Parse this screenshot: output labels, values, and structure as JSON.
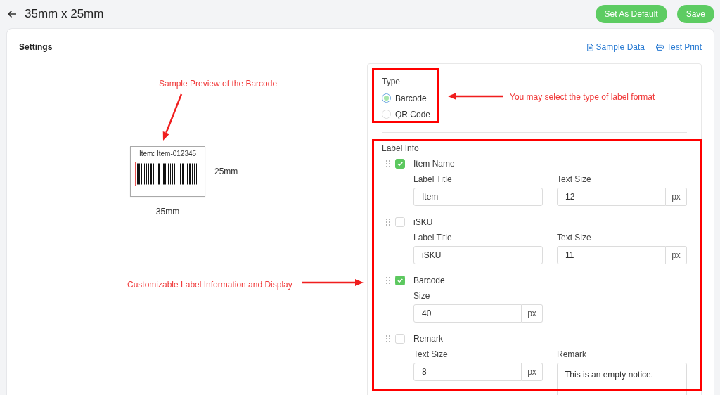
{
  "header": {
    "title": "35mm x 25mm",
    "buttons": [
      "Set As Default",
      "Save"
    ]
  },
  "settings": {
    "title": "Settings",
    "links": [
      {
        "label": "Sample Data",
        "kind": "document"
      },
      {
        "label": "Test Print",
        "kind": "print"
      }
    ]
  },
  "preview": {
    "item_text": "Item: Item-012345",
    "height": "25mm",
    "width": "35mm"
  },
  "type": {
    "title": "Type",
    "options": [
      {
        "label": "Barcode",
        "selected": true
      },
      {
        "label": "QR Code",
        "selected": false
      }
    ]
  },
  "label_info": {
    "title": "Label Info",
    "fields": [
      {
        "name": "Item Name",
        "checked": true,
        "inputs": [
          {
            "label": "Label Title",
            "kind": "text",
            "value": "Item"
          },
          {
            "label": "Text Size",
            "kind": "unit",
            "value": "12",
            "unit": "px"
          }
        ]
      },
      {
        "name": "iSKU",
        "checked": false,
        "inputs": [
          {
            "label": "Label Title",
            "kind": "text",
            "value": "iSKU"
          },
          {
            "label": "Text Size",
            "kind": "unit",
            "value": "11",
            "unit": "px"
          }
        ]
      },
      {
        "name": "Barcode",
        "checked": true,
        "inputs": [
          {
            "label": "Size",
            "kind": "unit",
            "value": "40",
            "unit": "px"
          }
        ]
      },
      {
        "name": "Remark",
        "checked": false,
        "inputs": [
          {
            "label": "Text Size",
            "kind": "unit",
            "value": "8",
            "unit": "px"
          },
          {
            "label": "Remark",
            "kind": "textarea",
            "value": "This is an empty notice."
          }
        ]
      }
    ]
  },
  "annotations": [
    {
      "text": "Sample Preview of the Barcode"
    },
    {
      "text": "You may select the type of label format"
    },
    {
      "text": "Customizable Label Information and Display"
    }
  ]
}
